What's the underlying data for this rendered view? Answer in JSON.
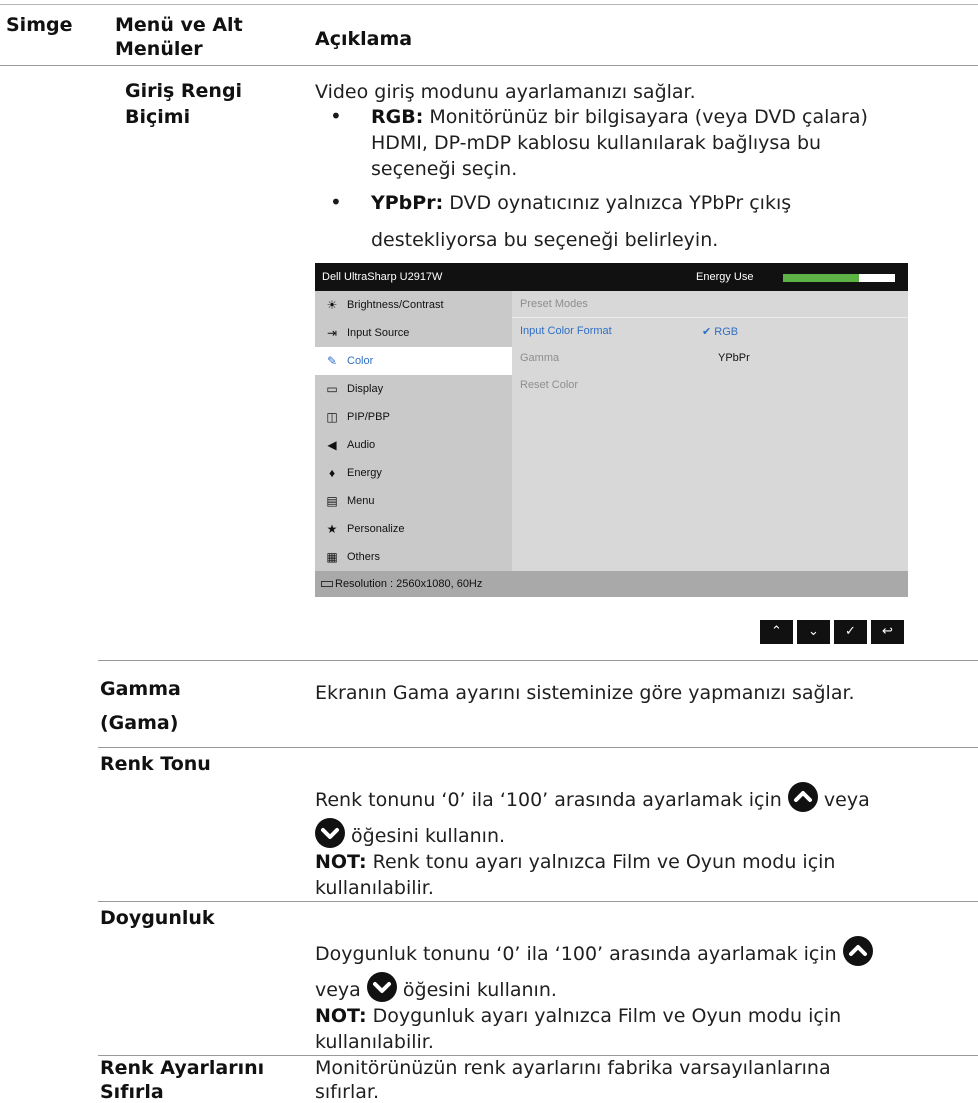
{
  "header": {
    "col_icon": "Simge",
    "col_menu": "Menü ve Alt Menüler",
    "col_menu_l1": "Menü ve Alt",
    "col_menu_l2": "Menüler",
    "col_desc": "Açıklama"
  },
  "rows": {
    "input_color": {
      "title_l1": "Giriş Rengi",
      "title_l2": "Biçimi",
      "intro": "Video giriş modunu ayarlamanızı sağlar.",
      "rgb_label": "RGB:",
      "rgb_l1": "Monitörünüz bir bilgisayara (veya DVD çalara)",
      "rgb_l2": "HDMI, DP-mDP kablosu kullanılarak bağlıysa bu",
      "rgb_l3": "seçeneği seçin.",
      "ypbpr_label": "YPbPr:",
      "ypbpr_l1": "DVD oynatıcınız yalnızca YPbPr çıkış",
      "ypbpr_l2": "destekliyorsa bu seçeneği belirleyin."
    },
    "gamma": {
      "title_l1": "Gamma",
      "title_l2": "(Gama)",
      "desc": "Ekranın Gama ayarını sisteminize göre yapmanızı sağlar."
    },
    "hue": {
      "title": "Renk Tonu",
      "l1": "Renk tonunu ‘0’ ila ‘100’ arasında ayarlamak için",
      "l1_after": "veya",
      "l2": "öğesini kullanın.",
      "note_label": "NOT:",
      "note_l1": "Renk tonu ayarı yalnızca Film ve Oyun modu için",
      "note_l2": "kullanılabilir."
    },
    "saturation": {
      "title": "Doygunluk",
      "l1": "Doygunluk tonunu ‘0’ ila ‘100’ arasında ayarlamak için",
      "l2_before": "veya",
      "l2": "öğesini kullanın.",
      "note_label": "NOT:",
      "note_l1": "Doygunluk ayarı yalnızca Film ve Oyun modu için",
      "note_l2": "kullanılabilir."
    },
    "reset": {
      "title_l1": "Renk Ayarlarını",
      "title_l2": "Sıfırla",
      "l1": "Monitörünüzün renk ayarlarını fabrika varsayılanlarına",
      "l2": "sıfırlar."
    }
  },
  "osd": {
    "title": "Dell UltraSharp U2917W",
    "energy_label": "Energy Use",
    "energy_level": 0.68,
    "menu": [
      {
        "label": "Brightness/Contrast",
        "icon": "sun-icon"
      },
      {
        "label": "Input Source",
        "icon": "input-source-icon"
      },
      {
        "label": "Color",
        "icon": "color-icon"
      },
      {
        "label": "Display",
        "icon": "display-icon"
      },
      {
        "label": "PIP/PBP",
        "icon": "pip-icon"
      },
      {
        "label": "Audio",
        "icon": "speaker-icon"
      },
      {
        "label": "Energy",
        "icon": "energy-icon"
      },
      {
        "label": "Menu",
        "icon": "menu-icon"
      },
      {
        "label": "Personalize",
        "icon": "star-icon"
      },
      {
        "label": "Others",
        "icon": "others-icon"
      }
    ],
    "submenu": [
      {
        "label": "Preset Modes",
        "value": ""
      },
      {
        "label": "Input Color Format",
        "value": "RGB"
      },
      {
        "label": "Gamma",
        "value": "YPbPr"
      },
      {
        "label": "Reset Color",
        "value": ""
      }
    ],
    "resolution": "Resolution : 2560x1080, 60Hz",
    "colors": {
      "selected_text": "#2f6fc4",
      "dim_text": "#8e8e8e",
      "energy": "#5cb244"
    }
  },
  "buttons": [
    {
      "icon": "up-icon",
      "glyph": "⌃"
    },
    {
      "icon": "down-icon",
      "glyph": "⌄"
    },
    {
      "icon": "check-icon",
      "glyph": "✓"
    },
    {
      "icon": "back-icon",
      "glyph": "↩"
    }
  ]
}
